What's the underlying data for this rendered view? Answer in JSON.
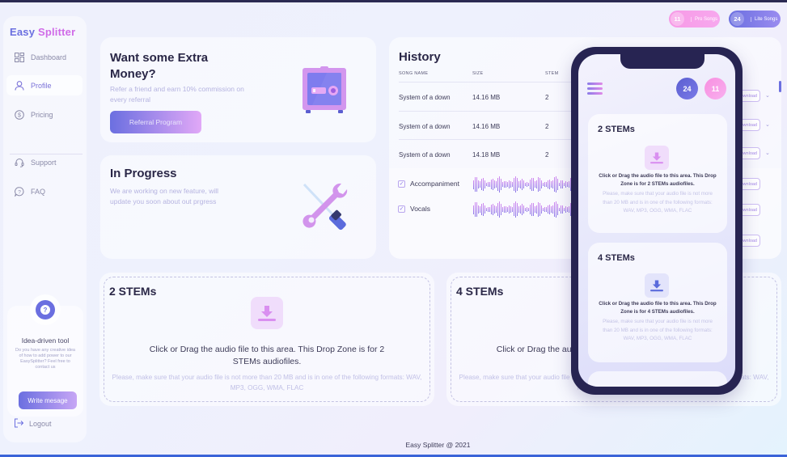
{
  "brand": {
    "part1": "Easy ",
    "part2": "Splitter"
  },
  "sidebar": {
    "items": [
      {
        "label": "Dashboard",
        "icon": "dashboard-icon",
        "active": false
      },
      {
        "label": "Profile",
        "icon": "user-icon",
        "active": true
      },
      {
        "label": "Pricing",
        "icon": "dollar-icon",
        "active": false
      },
      {
        "label": "Support",
        "icon": "headset-icon",
        "active": false
      },
      {
        "label": "FAQ",
        "icon": "question-bubble-icon",
        "active": false
      }
    ],
    "idea_card": {
      "title": "Idea-driven tool",
      "text": "Do you have any creative idea of how to add power to our EasySplitter? Feel free to contact us",
      "button": "Write mesage"
    },
    "logout": "Logout"
  },
  "top_badges": {
    "pro": {
      "count": "11",
      "label": "Pro Songs",
      "color": "#f78fe0"
    },
    "lite": {
      "count": "24",
      "label": "Lite Songs",
      "color": "#6b6fe0"
    }
  },
  "referral": {
    "title_line1": "Want some Extra",
    "title_line2": "Money?",
    "text": "Refer a friend and earn 10% commission on every referral",
    "button": "Referral Program"
  },
  "progress": {
    "title": "In Progress",
    "text": "We are working on new feature, will update you soon about out prgress"
  },
  "history": {
    "title": "History",
    "columns": [
      "SONG NAME",
      "SIZE",
      "STEM"
    ],
    "rows": [
      {
        "name": "System of a down",
        "size": "14.16 MB",
        "stem": "2"
      },
      {
        "name": "System of a down",
        "size": "14.16 MB",
        "stem": "2"
      },
      {
        "name": "System of a down",
        "size": "14.18 MB",
        "stem": "2"
      }
    ],
    "tracks": [
      {
        "label": "Accompaniment",
        "checked": true
      },
      {
        "label": "Vocals",
        "checked": true
      }
    ],
    "download_label": "Download"
  },
  "drop_zones": [
    {
      "title": "2 STEMs",
      "main": "Click or Drag the audio file to this area. This Drop Zone is for 2 STEMs audiofiles.",
      "hint": "Please, make sure that your audio file is not more than 20 MB and is in one of the following formats: WAV, MP3, OGG, WMA, FLAC"
    },
    {
      "title": "4 STEMs",
      "main": "Click or Drag the audio file to this area. This Drop Zone is for 4 STEMs audiofiles.",
      "hint": "Please, make sure that your audio file is not more than 20 MB and is in one of the following formats: WAV, MP3, OGG, WMA, FLAC"
    }
  ],
  "phone": {
    "lite_count": "24",
    "pro_count": "11",
    "cards": [
      {
        "title": "2 STEMs",
        "main": "Click or Drag the audio file to this area. This Drop Zone is for 2 STEMs audiofiles.",
        "hint": "Please, make sure that your audio file is not more than 20 MB and is in one of the following formats: WAV, MP3, OGG, WMA, FLAC"
      },
      {
        "title": "4 STEMs",
        "main": "Click or Drag the audio file to this area. This Drop Zone is for 4 STEMs audiofiles.",
        "hint": "Please, make sure that your audio file is not more than 20 MB and is in one of the following formats: WAV, MP3, OGG, WMA, FLAC"
      }
    ]
  },
  "footer": "Easy Splitter @ 2021"
}
